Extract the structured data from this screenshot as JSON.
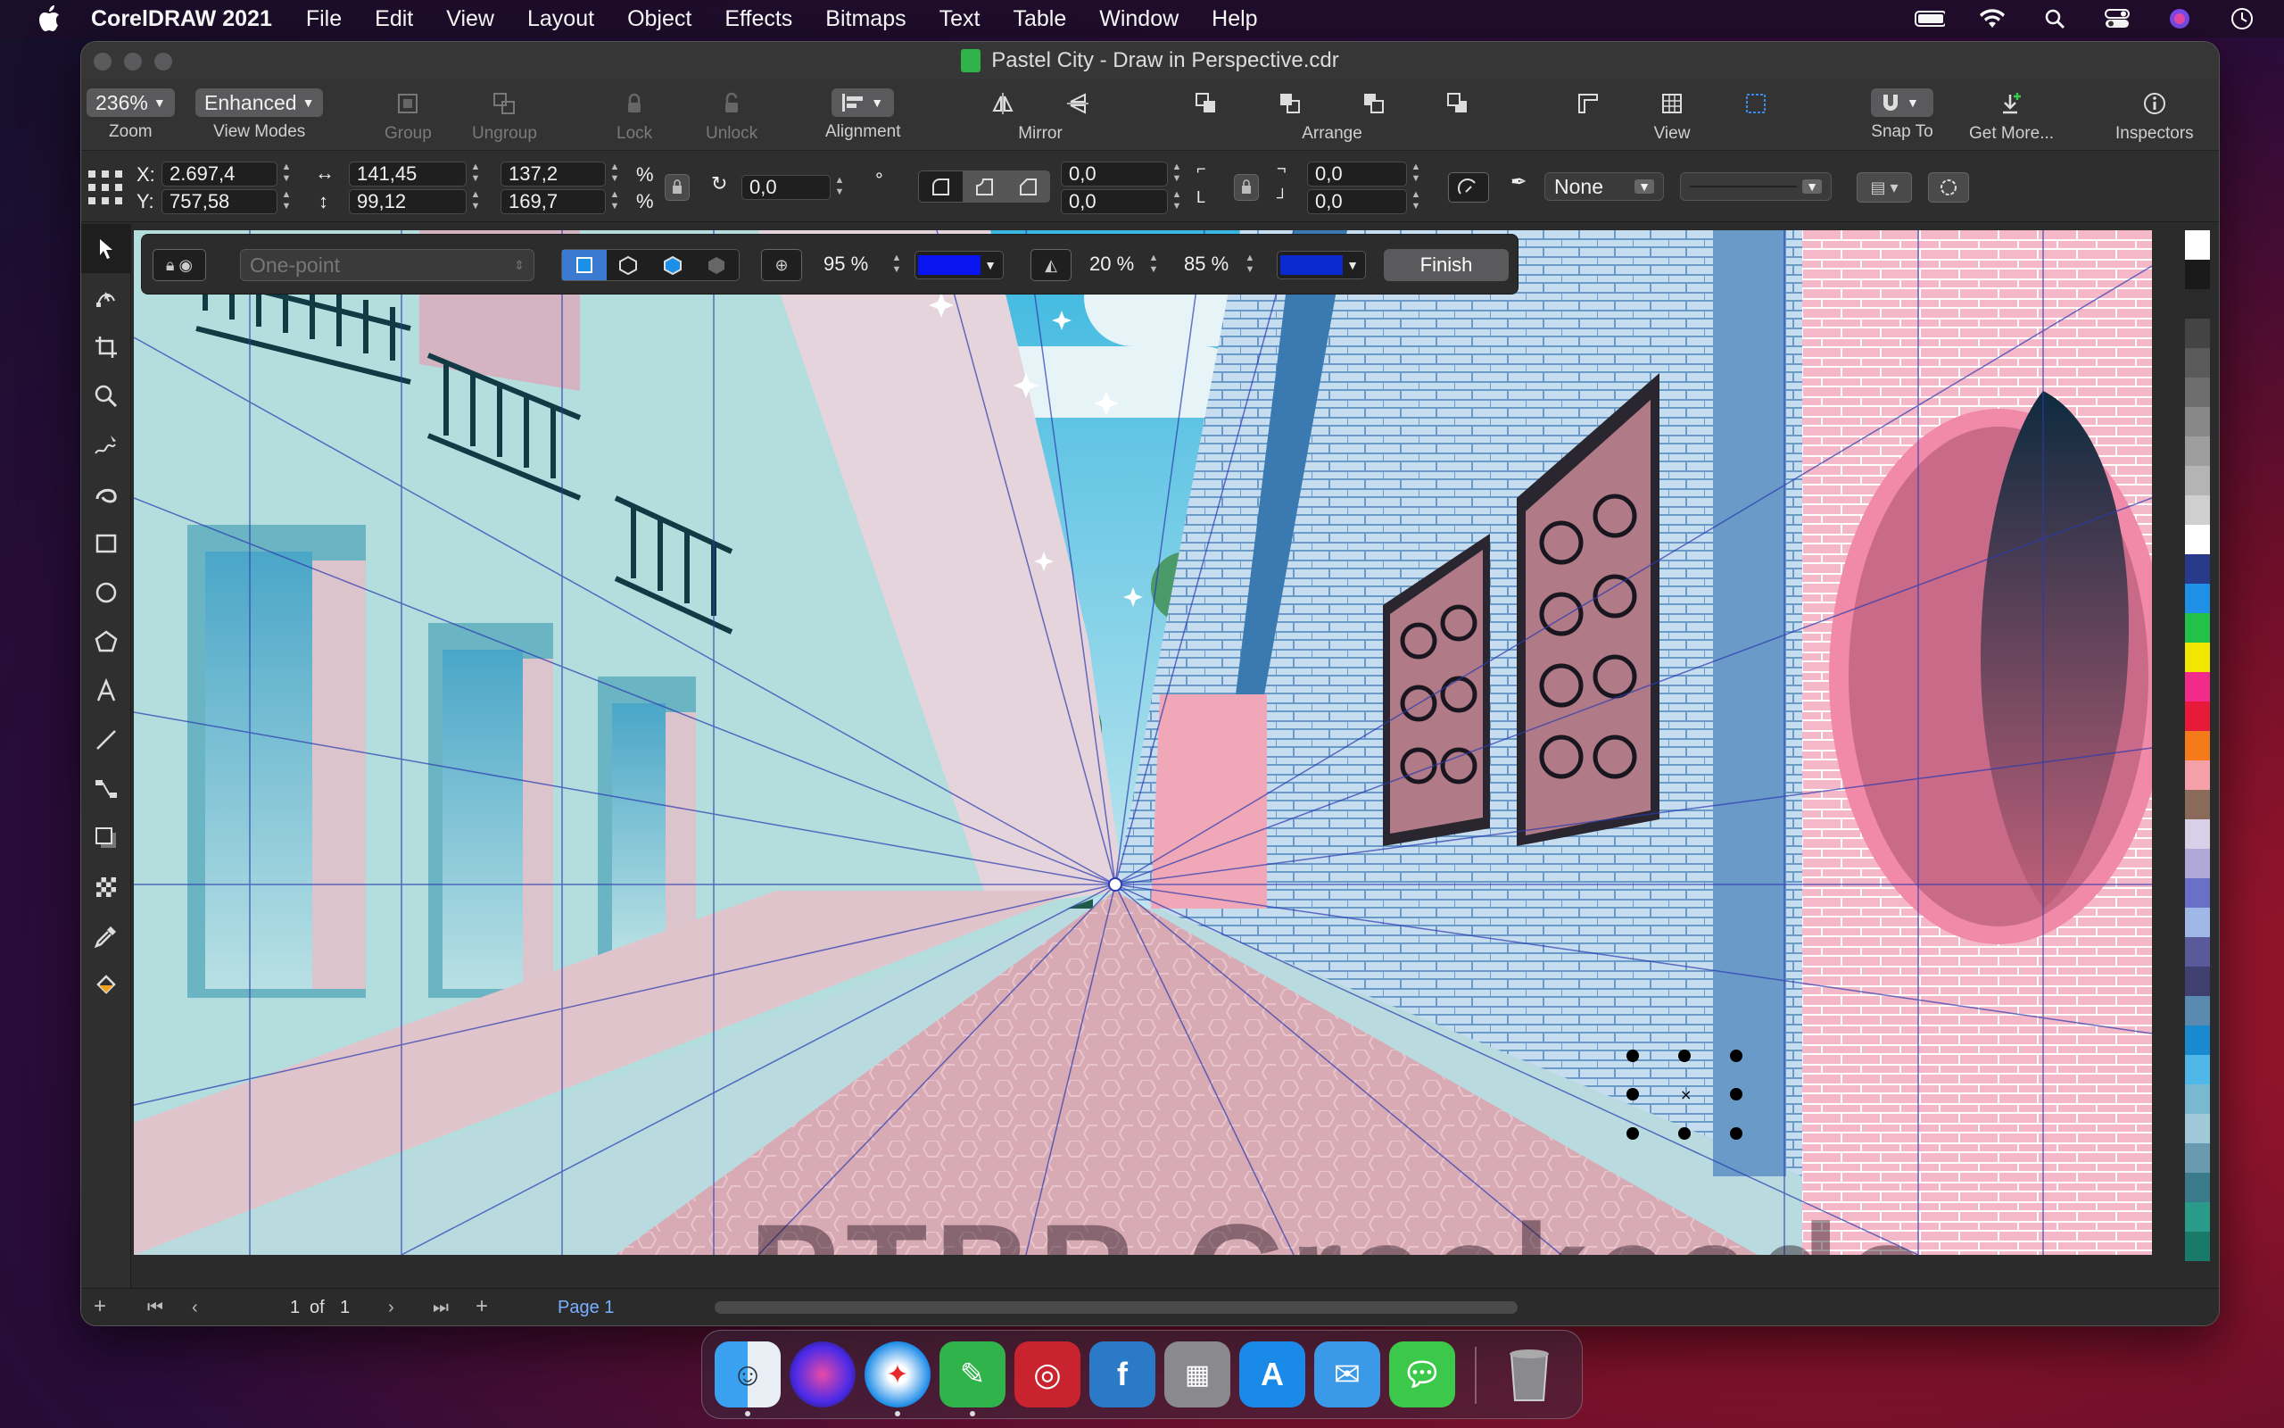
{
  "menubar": {
    "app_name": "CorelDRAW 2021",
    "items": [
      "File",
      "Edit",
      "View",
      "Layout",
      "Object",
      "Effects",
      "Bitmaps",
      "Text",
      "Table",
      "Window",
      "Help"
    ]
  },
  "window": {
    "title": "Pastel City - Draw in Perspective.cdr"
  },
  "toolbar": {
    "zoom_value": "236%",
    "zoom_label": "Zoom",
    "view_mode_value": "Enhanced",
    "view_mode_label": "View Modes",
    "group_label": "Group",
    "ungroup_label": "Ungroup",
    "lock_label": "Lock",
    "unlock_label": "Unlock",
    "alignment_label": "Alignment",
    "mirror_label": "Mirror",
    "arrange_label": "Arrange",
    "view_label": "View",
    "snap_label": "Snap To",
    "get_more_label": "Get More...",
    "inspectors_label": "Inspectors"
  },
  "propbar": {
    "x_label": "X:",
    "y_label": "Y:",
    "x_value": "2.697,4",
    "y_value": "757,58",
    "width_value": "141,45",
    "height_value": "99,12",
    "scale_w": "137,2",
    "scale_h": "169,7",
    "percent": "%",
    "rotation": "0,0",
    "degree": "°",
    "pos1": "0,0",
    "pos2": "0,0",
    "pos3": "0,0",
    "pos4": "0,0",
    "outline_value": "None"
  },
  "perspective_bar": {
    "mode": "One-point",
    "opacity1": "95 %",
    "opacity2": "20 %",
    "opacity3": "85 %",
    "finish_label": "Finish",
    "color1": "#0a14f0",
    "color2": "#0a2ad0"
  },
  "bottombar": {
    "page_num": "1",
    "page_of": "of",
    "page_total": "1",
    "page_tab": "Page 1"
  },
  "palette": [
    "#ffffff",
    "#1a1a1a",
    "#2a2a2a",
    "#444",
    "#5a5a5a",
    "#6e6e6e",
    "#888",
    "#9e9e9e",
    "#b4b4b4",
    "#cfcfcf",
    "#ffffff",
    "#2a3a8a",
    "#1e90e8",
    "#22c24a",
    "#f2e500",
    "#f22a8a",
    "#e81a3a",
    "#f57a1a",
    "#f5a0a8",
    "#8a6a5a",
    "#d8d0e8",
    "#b0a8d8",
    "#6a70c8",
    "#a0b8e8",
    "#5a5a9a",
    "#404070",
    "#5a8ab0",
    "#1a8ad0",
    "#50b8e8",
    "#7ab8d0",
    "#a0c8d8",
    "#6a9ab0",
    "#3a7a8a",
    "#2a9a8a",
    "#1a7a6a"
  ],
  "watermark": "PTBR Crackeado"
}
